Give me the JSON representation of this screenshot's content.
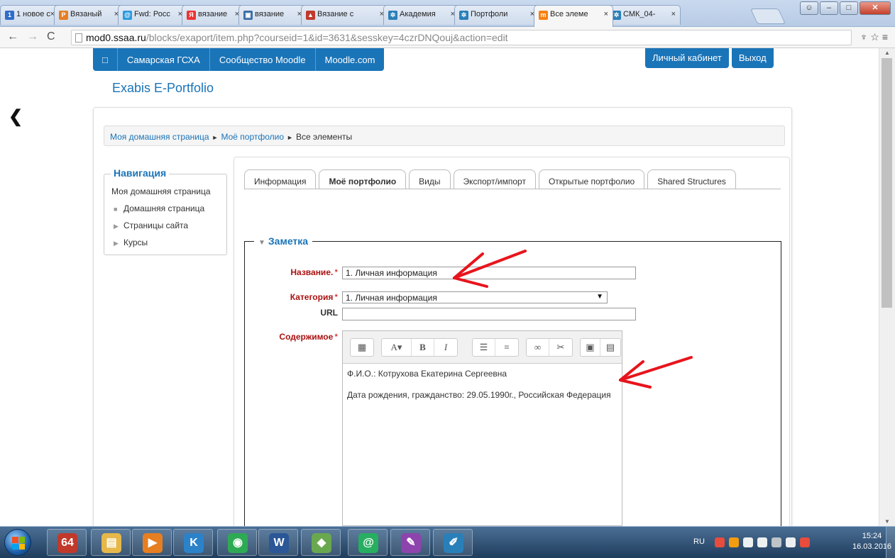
{
  "browser": {
    "tabs": [
      {
        "title": "1 новое с",
        "favicon": "mail-icon",
        "color": "#2f6cc7",
        "glyph": "1"
      },
      {
        "title": "Вязаный",
        "favicon": "pinterest-icon",
        "color": "#e67e22",
        "glyph": "P"
      },
      {
        "title": "Fwd: Росс",
        "favicon": "mail-icon",
        "color": "#2b9be0",
        "glyph": "@"
      },
      {
        "title": "вязание",
        "favicon": "yandex-icon",
        "color": "#e33",
        "glyph": "Я"
      },
      {
        "title": "вязание",
        "favicon": "image-icon",
        "color": "#3a6ea5",
        "glyph": "▣"
      },
      {
        "title": "Вязание с",
        "favicon": "liveinternet-icon",
        "color": "#c0392b",
        "glyph": "▲"
      },
      {
        "title": "Академия",
        "favicon": "academy-icon",
        "color": "#2a7fb8",
        "glyph": "✲"
      },
      {
        "title": "Портфоли",
        "favicon": "academy-icon",
        "color": "#2a7fb8",
        "glyph": "✲"
      },
      {
        "title": "Все элеме",
        "favicon": "moodle-icon",
        "color": "#f98012",
        "glyph": "m"
      },
      {
        "title": "СМК_04-",
        "favicon": "academy-icon",
        "color": "#2a7fb8",
        "glyph": "✲"
      }
    ],
    "url_host": "mod0.ssaa.ru",
    "url_path": "/blocks/exaport/item.php?courseid=1&id=3631&sesskey=4czrDNQouj&action=edit"
  },
  "topnav": {
    "home_glyph": "□",
    "links": [
      "Самарская ГСХА",
      "Сообщество Moodle",
      "Moodle.com"
    ],
    "right": [
      "Личный кабинет",
      "Выход"
    ]
  },
  "site_title": "Exabis E-Portfolio",
  "breadcrumb": [
    "Моя домашняя страница",
    "Моё портфолио",
    "Все элементы"
  ],
  "breadcrumb_sep": "►",
  "navigation": {
    "title": "Навигация",
    "home": "Моя домашняя страница",
    "items": [
      "Домашняя страница",
      "Страницы сайта",
      "Курсы"
    ]
  },
  "portfolio_tabs": [
    "Информация",
    "Моё портфолио",
    "Виды",
    "Экспорт/импорт",
    "Открытые портфолио",
    "Shared Structures"
  ],
  "form": {
    "legend": "Заметка",
    "name_label": "Название.",
    "name_value": "1. Личная информация",
    "category_label": "Категория",
    "category_value": "1. Личная информация",
    "url_label": "URL",
    "url_value": "",
    "content_label": "Содержимое",
    "required_mark": "*",
    "content_lines": [
      "Ф.И.О.: Котрухова Екатерина Сергеевна",
      "Дата рождения, гражданство: 29.05.1990г., Российская Федерация"
    ]
  },
  "taskbar": {
    "lang": "RU",
    "time": "15:24",
    "date": "16.03.2016",
    "apps": [
      {
        "name": "taskbar-app-64",
        "glyph": "64",
        "color": "#c0392b"
      },
      {
        "name": "taskbar-app-explorer",
        "glyph": "▤",
        "color": "#e6b84a"
      },
      {
        "name": "taskbar-app-media",
        "glyph": "▶",
        "color": "#e67e22"
      },
      {
        "name": "taskbar-app-k",
        "glyph": "K",
        "color": "#2c82c9"
      },
      {
        "name": "taskbar-app-chrome",
        "glyph": "◉",
        "color": "#2eaa55"
      },
      {
        "name": "taskbar-app-word",
        "glyph": "W",
        "color": "#2b5797"
      },
      {
        "name": "taskbar-app-green",
        "glyph": "◆",
        "color": "#6aa84f"
      },
      {
        "name": "taskbar-app-at",
        "glyph": "@",
        "color": "#27ae60"
      },
      {
        "name": "taskbar-app-paint",
        "glyph": "✎",
        "color": "#8e44ad"
      },
      {
        "name": "taskbar-app-draw",
        "glyph": "✐",
        "color": "#2980b9"
      }
    ]
  },
  "colors": {
    "accent": "#1a74b8",
    "required": "#a11",
    "arrow": "#e8141c"
  }
}
